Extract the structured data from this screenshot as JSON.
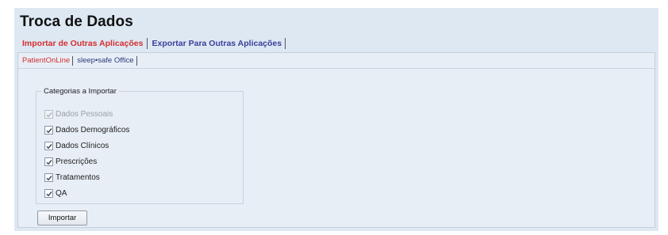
{
  "page": {
    "title": "Troca de Dados"
  },
  "main_tabs": [
    {
      "label": "Importar de Outras Aplicações",
      "active": true
    },
    {
      "label": "Exportar Para Outras Aplicações",
      "active": false
    }
  ],
  "sub_tabs": [
    {
      "label": "PatientOnLine",
      "active": true
    },
    {
      "label": "sleep•safe Office",
      "active": false
    }
  ],
  "categories": {
    "legend": "Categorias a Importar",
    "items": [
      {
        "label": "Dados Pessoais",
        "checked": true,
        "enabled": false
      },
      {
        "label": "Dados Demográficos",
        "checked": true,
        "enabled": true
      },
      {
        "label": "Dados Clínicos",
        "checked": true,
        "enabled": true
      },
      {
        "label": "Prescrições",
        "checked": true,
        "enabled": true
      },
      {
        "label": "Tratamentos",
        "checked": true,
        "enabled": true
      },
      {
        "label": "QA",
        "checked": true,
        "enabled": true
      }
    ]
  },
  "import_button": {
    "label": "Importar"
  },
  "colors": {
    "active_tab": "#d32f2f",
    "inactive_tab": "#3a3f9a",
    "page_background": "#dde8f3"
  }
}
